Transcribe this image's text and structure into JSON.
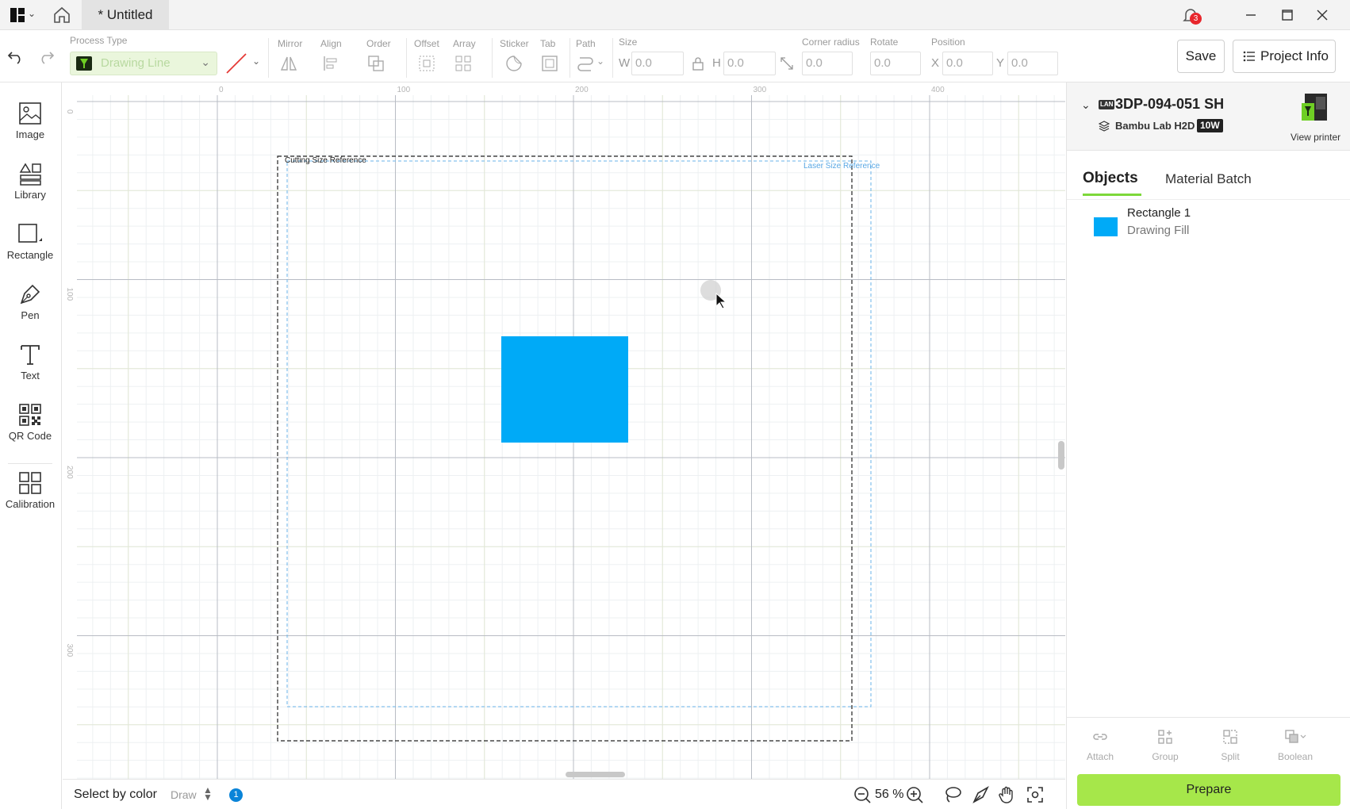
{
  "titlebar": {
    "tab_title": "* Untitled",
    "notification_count": "3"
  },
  "toolbar": {
    "process_type_label": "Process Type",
    "process_type_value": "Drawing Line",
    "mirror_label": "Mirror",
    "align_label": "Align",
    "order_label": "Order",
    "offset_label": "Offset",
    "array_label": "Array",
    "sticker_label": "Sticker",
    "tab_label": "Tab",
    "path_label": "Path",
    "size_label": "Size",
    "w_prefix": "W",
    "w_value": "0.0",
    "h_prefix": "H",
    "h_value": "0.0",
    "corner_radius_label": "Corner radius",
    "corner_radius_value": "0.0",
    "rotate_label": "Rotate",
    "rotate_value": "0.0",
    "position_label": "Position",
    "x_prefix": "X",
    "x_value": "0.0",
    "y_prefix": "Y",
    "y_value": "0.0",
    "save_label": "Save",
    "project_info_label": "Project Info"
  },
  "leftrail": {
    "tools": [
      {
        "label": "Image"
      },
      {
        "label": "Library"
      },
      {
        "label": "Rectangle"
      },
      {
        "label": "Pen"
      },
      {
        "label": "Text"
      },
      {
        "label": "QR Code"
      },
      {
        "label": "Calibration"
      }
    ]
  },
  "canvas": {
    "ruler_top": [
      "0",
      "100",
      "200",
      "300",
      "400"
    ],
    "ruler_left": [
      "0",
      "100",
      "200",
      "300"
    ],
    "cutting_ref_label": "Cutting Size Reference",
    "laser_ref_label": "Laser Size Reference",
    "object_color": "#00aaf7"
  },
  "bottombar": {
    "select_by_color": "Select by color",
    "draw_mode": "Draw",
    "info_badge": "1",
    "zoom_value": "56 %"
  },
  "rightpanel": {
    "printer_connection": "LAN",
    "printer_name": "3DP-094-051 SH",
    "printer_model": "Bambu Lab H2D",
    "laser_power": "10W",
    "view_printer": "View printer",
    "tabs": [
      "Objects",
      "Material Batch"
    ],
    "objects": [
      {
        "name": "Rectangle 1",
        "process": "Drawing Fill",
        "color": "#00aaf7"
      }
    ],
    "actions": [
      "Attach",
      "Group",
      "Split",
      "Boolean"
    ],
    "prepare_label": "Prepare"
  },
  "colors": {
    "accent": "#a6e74a",
    "accent_underline": "#7dd83a",
    "badge": "#e8262c"
  }
}
